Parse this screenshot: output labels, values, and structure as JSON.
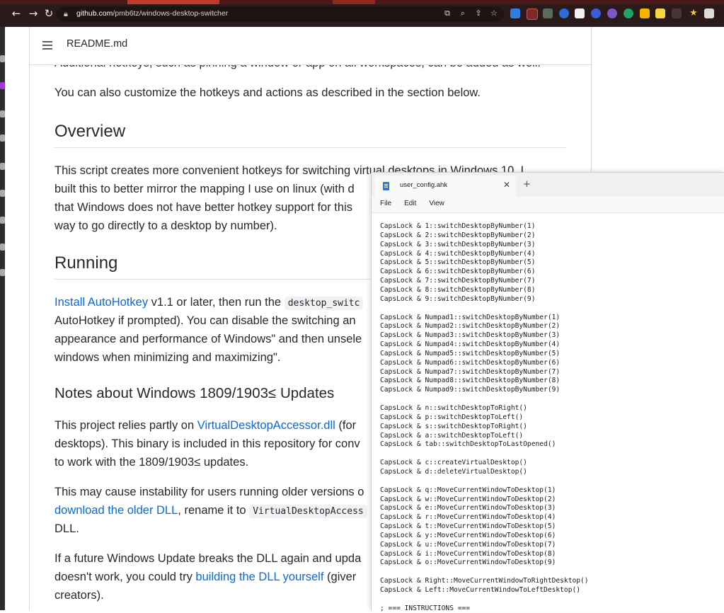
{
  "browser": {
    "url_host": "github.com",
    "url_path": "/pmb6tz/windows-desktop-switcher"
  },
  "readme": {
    "file_title": "README.md"
  },
  "content": {
    "partial_top": "Additional hotkeys, such as pinning a window or app on all workspaces, can be added as well.",
    "p_customize": "You can also customize the hotkeys and actions as described in the section below.",
    "h_overview": "Overview",
    "overview_lines": [
      "This script creates more convenient hotkeys for switching virtual desktops in Windows 10. I",
      "built this to better mirror the mapping I use on linux (with d",
      "that Windows does not have better hotkey support for this",
      "way to go directly to a desktop by number)."
    ],
    "h_running": "Running",
    "running": {
      "link": "Install AutoHotkey",
      "text1": " v1.1 or later, then run the ",
      "code": "desktop_switc",
      "line2": "AutoHotkey if prompted). You can disable the switching an",
      "line3": "appearance and performance of Windows\" and then unsele",
      "line4": "windows when minimizing and maximizing\"."
    },
    "h_notes": "Notes about Windows 1809/1903≤ Updates",
    "notes1": {
      "pre": "This project relies partly on ",
      "link": "VirtualDesktopAccessor.dll",
      "post": " (for",
      "line2": "desktops). This binary is included in this repository for conv",
      "line3": "to work with the 1809/1903≤ updates."
    },
    "notes2": {
      "line1": "This may cause instability for users running older versions o",
      "link": "download the older DLL",
      "mid": ", rename it to ",
      "code": "VirtualDesktopAccess",
      "line3": "DLL."
    },
    "notes3": {
      "line1": "If a future Windows Update breaks the DLL again and upda",
      "pre": "doesn't work, you could try ",
      "link": "building the DLL yourself",
      "post": " (giver",
      "line3": "creators)."
    }
  },
  "notepad": {
    "tab_name": "user_config.ahk",
    "menu": [
      "File",
      "Edit",
      "View"
    ],
    "lines": [
      "CapsLock & 1::switchDesktopByNumber(1)",
      "CapsLock & 2::switchDesktopByNumber(2)",
      "CapsLock & 3::switchDesktopByNumber(3)",
      "CapsLock & 4::switchDesktopByNumber(4)",
      "CapsLock & 5::switchDesktopByNumber(5)",
      "CapsLock & 6::switchDesktopByNumber(6)",
      "CapsLock & 7::switchDesktopByNumber(7)",
      "CapsLock & 8::switchDesktopByNumber(8)",
      "CapsLock & 9::switchDesktopByNumber(9)",
      "",
      "CapsLock & Numpad1::switchDesktopByNumber(1)",
      "CapsLock & Numpad2::switchDesktopByNumber(2)",
      "CapsLock & Numpad3::switchDesktopByNumber(3)",
      "CapsLock & Numpad4::switchDesktopByNumber(4)",
      "CapsLock & Numpad5::switchDesktopByNumber(5)",
      "CapsLock & Numpad6::switchDesktopByNumber(6)",
      "CapsLock & Numpad7::switchDesktopByNumber(7)",
      "CapsLock & Numpad8::switchDesktopByNumber(8)",
      "CapsLock & Numpad9::switchDesktopByNumber(9)",
      "",
      "CapsLock & n::switchDesktopToRight()",
      "CapsLock & p::switchDesktopToLeft()",
      "CapsLock & s::switchDesktopToRight()",
      "CapsLock & a::switchDesktopToLeft()",
      "CapsLock & tab::switchDesktopToLastOpened()",
      "",
      "CapsLock & c::createVirtualDesktop()",
      "CapsLock & d::deleteVirtualDesktop()",
      "",
      "CapsLock & q::MoveCurrentWindowToDesktop(1)",
      "CapsLock & w::MoveCurrentWindowToDesktop(2)",
      "CapsLock & e::MoveCurrentWindowToDesktop(3)",
      "CapsLock & r::MoveCurrentWindowToDesktop(4)",
      "CapsLock & t::MoveCurrentWindowToDesktop(5)",
      "CapsLock & y::MoveCurrentWindowToDesktop(6)",
      "CapsLock & u::MoveCurrentWindowToDesktop(7)",
      "CapsLock & i::MoveCurrentWindowToDesktop(8)",
      "CapsLock & o::MoveCurrentWindowToDesktop(9)",
      "",
      "CapsLock & Right::MoveCurrentWindowToRightDesktop()",
      "CapsLock & Left::MoveCurrentWindowToLeftDesktop()",
      "",
      "; === INSTRUCTIONS ==="
    ]
  }
}
